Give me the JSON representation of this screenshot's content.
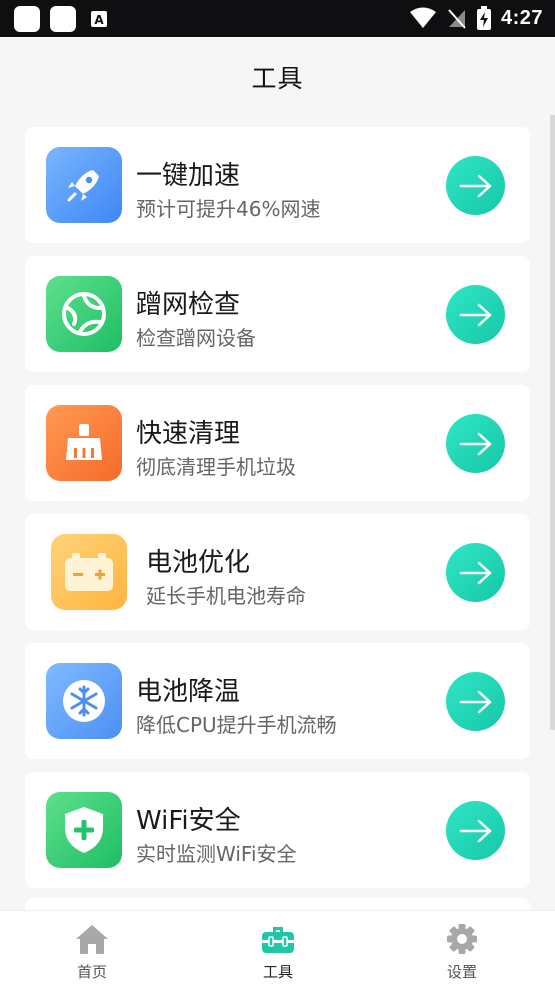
{
  "status_bar": {
    "time": "4:27"
  },
  "header": {
    "title": "工具"
  },
  "tools": [
    {
      "title": "一键加速",
      "subtitle": "预计可提升46%网速",
      "icon": "rocket-icon"
    },
    {
      "title": "蹭网检查",
      "subtitle": "检查蹭网设备",
      "icon": "globe-icon"
    },
    {
      "title": "快速清理",
      "subtitle": "彻底清理手机垃圾",
      "icon": "broom-icon"
    },
    {
      "title": "电池优化",
      "subtitle": "延长手机电池寿命",
      "icon": "battery-icon"
    },
    {
      "title": "电池降温",
      "subtitle": "降低CPU提升手机流畅",
      "icon": "snowflake-icon"
    },
    {
      "title": "WiFi安全",
      "subtitle": "实时监测WiFi安全",
      "icon": "shield-plus-icon"
    }
  ],
  "colors": {
    "accent": "#1fd3b3",
    "active_tab": "#1fc7a6",
    "inactive_tab": "#a8a8a8"
  },
  "nav": {
    "items": [
      {
        "label": "首页",
        "icon": "home-icon"
      },
      {
        "label": "工具",
        "icon": "toolbox-icon"
      },
      {
        "label": "设置",
        "icon": "gear-icon"
      }
    ]
  }
}
